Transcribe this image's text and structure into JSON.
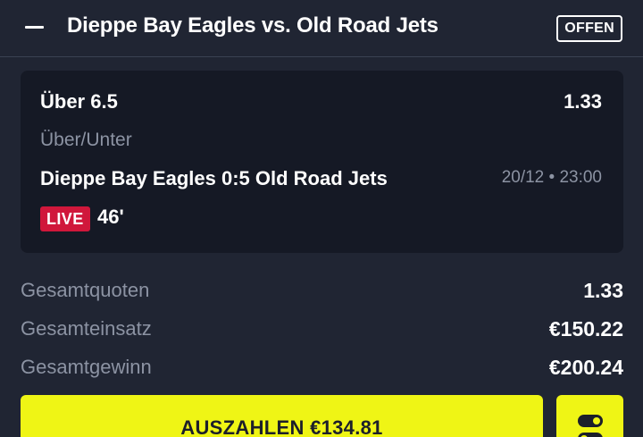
{
  "header": {
    "collapse_icon": "minus-icon",
    "title": "Dieppe Bay Eagles vs. Old Road Jets",
    "status": "OFFEN"
  },
  "bet": {
    "selection": "Über 6.5",
    "odds": "1.33",
    "market": "Über/Unter",
    "event": "Dieppe Bay Eagles 0:5 Old Road Jets",
    "datetime": "20/12 • 23:00",
    "live_label": "LIVE",
    "minute": "46'"
  },
  "summary": {
    "total_odds_label": "Gesamtquoten",
    "total_odds_value": "1.33",
    "total_stake_label": "Gesamteinsatz",
    "total_stake_value": "€150.22",
    "total_win_label": "Gesamtgewinn",
    "total_win_value": "€200.24"
  },
  "actions": {
    "cashout_label": "AUSZAHLEN €134.81",
    "settings_icon": "toggle-settings-icon"
  },
  "colors": {
    "background": "#202533",
    "card": "#151925",
    "accent": "#eff515",
    "live": "#d0173b",
    "muted_text": "#8c93a3"
  }
}
